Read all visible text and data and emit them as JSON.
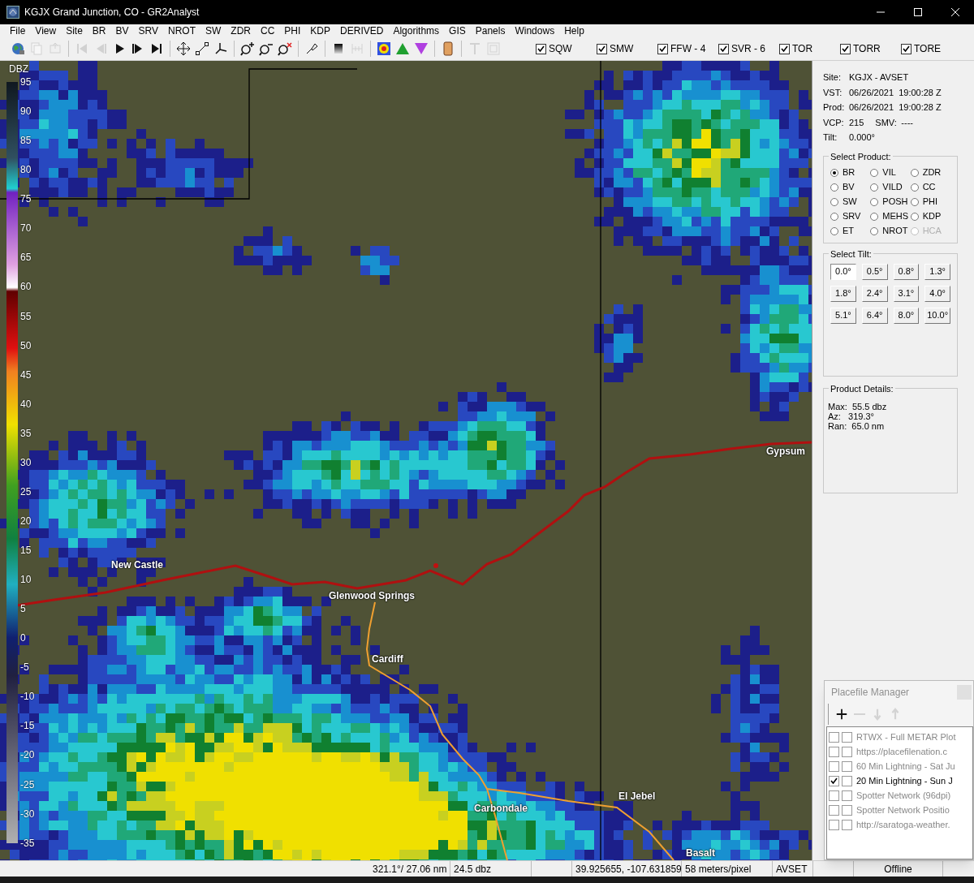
{
  "window": {
    "title": "KGJX Grand Junction, CO - GR2Analyst"
  },
  "menu": [
    "File",
    "View",
    "Site",
    "BR",
    "BV",
    "SRV",
    "NROT",
    "SW",
    "ZDR",
    "CC",
    "PHI",
    "KDP",
    "DERIVED",
    "Algorithms",
    "GIS",
    "Panels",
    "Windows",
    "Help"
  ],
  "toolbar": [
    {
      "kind": "globe",
      "disabled": false
    },
    {
      "kind": "copy",
      "disabled": true
    },
    {
      "kind": "export",
      "disabled": true
    },
    {
      "kind": "separator"
    },
    {
      "kind": "first",
      "disabled": true
    },
    {
      "kind": "prev",
      "disabled": true
    },
    {
      "kind": "play",
      "disabled": false
    },
    {
      "kind": "next",
      "disabled": false
    },
    {
      "kind": "last",
      "disabled": false
    },
    {
      "kind": "separator"
    },
    {
      "kind": "pan",
      "disabled": false
    },
    {
      "kind": "measure",
      "disabled": false
    },
    {
      "kind": "fork",
      "disabled": false
    },
    {
      "kind": "separator"
    },
    {
      "kind": "zoomin",
      "disabled": false
    },
    {
      "kind": "zoomout",
      "disabled": false
    },
    {
      "kind": "zoomreset",
      "disabled": false
    },
    {
      "kind": "separator"
    },
    {
      "kind": "pick",
      "disabled": false
    },
    {
      "kind": "separator"
    },
    {
      "kind": "gradient",
      "disabled": false
    },
    {
      "kind": "grid",
      "disabled": true
    },
    {
      "kind": "separator"
    },
    {
      "kind": "colormap",
      "disabled": false
    },
    {
      "kind": "up",
      "disabled": false
    },
    {
      "kind": "down",
      "disabled": false
    },
    {
      "kind": "separator"
    },
    {
      "kind": "tan",
      "disabled": false
    },
    {
      "kind": "separator"
    },
    {
      "kind": "text",
      "disabled": true
    },
    {
      "kind": "frame",
      "disabled": true
    }
  ],
  "warning_filters": [
    {
      "label": "SQW",
      "checked": true
    },
    {
      "label": "SMW",
      "checked": true
    },
    {
      "label": "FFW - 4",
      "checked": true
    },
    {
      "label": "SVR - 6",
      "checked": true
    },
    {
      "label": "TOR",
      "checked": true
    },
    {
      "label": "TORR",
      "checked": true
    },
    {
      "label": "TORE",
      "checked": true
    }
  ],
  "color_scale": {
    "unit": "DBZ",
    "ticks": [
      "95",
      "90",
      "85",
      "80",
      "75",
      "70",
      "65",
      "60",
      "55",
      "50",
      "45",
      "40",
      "35",
      "30",
      "25",
      "20",
      "15",
      "10",
      "5",
      "0",
      "-5",
      "-10",
      "-15",
      "-20",
      "-25",
      "-30",
      "-35"
    ]
  },
  "map": {
    "places": [
      {
        "label": "Gypsum"
      },
      {
        "label": "New Castle"
      },
      {
        "label": "Glenwood Springs"
      },
      {
        "label": "Cardiff"
      },
      {
        "label": "Carbondale"
      },
      {
        "label": "El Jebel"
      },
      {
        "label": "Basalt"
      }
    ]
  },
  "info": [
    {
      "fields": [
        {
          "label": "Site:",
          "value": "KGJX - AVSET"
        }
      ]
    },
    {
      "fields": [
        {
          "label": "VST:",
          "value": "06/26/2021  19:00:28 Z"
        }
      ]
    },
    {
      "fields": [
        {
          "label": "Prod:",
          "value": "06/26/2021  19:00:28 Z"
        }
      ]
    },
    {
      "fields": [
        {
          "label": "VCP:",
          "value": "215"
        },
        {
          "label": "SMV:",
          "value": "----"
        }
      ]
    },
    {
      "fields": [
        {
          "label": "Tilt:",
          "value": "0.000°"
        }
      ]
    }
  ],
  "select_product": {
    "title": "Select Product:",
    "options": [
      {
        "label": "BR",
        "selected": true,
        "disabled": false
      },
      {
        "label": "VIL",
        "selected": false,
        "disabled": false
      },
      {
        "label": "ZDR",
        "selected": false,
        "disabled": false
      },
      {
        "label": "BV",
        "selected": false,
        "disabled": false
      },
      {
        "label": "VILD",
        "selected": false,
        "disabled": false
      },
      {
        "label": "CC",
        "selected": false,
        "disabled": false
      },
      {
        "label": "SW",
        "selected": false,
        "disabled": false
      },
      {
        "label": "POSH",
        "selected": false,
        "disabled": false
      },
      {
        "label": "PHI",
        "selected": false,
        "disabled": false
      },
      {
        "label": "SRV",
        "selected": false,
        "disabled": false
      },
      {
        "label": "MEHS",
        "selected": false,
        "disabled": false
      },
      {
        "label": "KDP",
        "selected": false,
        "disabled": false
      },
      {
        "label": "ET",
        "selected": false,
        "disabled": false
      },
      {
        "label": "NROT",
        "selected": false,
        "disabled": false
      },
      {
        "label": "HCA",
        "selected": false,
        "disabled": true
      }
    ]
  },
  "select_tilt": {
    "title": "Select Tilt:",
    "buttons": [
      {
        "label": "0.0°",
        "selected": true
      },
      {
        "label": "0.5°",
        "selected": false
      },
      {
        "label": "0.8°",
        "selected": false
      },
      {
        "label": "1.3°",
        "selected": false
      },
      {
        "label": "1.8°",
        "selected": false
      },
      {
        "label": "2.4°",
        "selected": false
      },
      {
        "label": "3.1°",
        "selected": false
      },
      {
        "label": "4.0°",
        "selected": false
      },
      {
        "label": "5.1°",
        "selected": false
      },
      {
        "label": "6.4°",
        "selected": false
      },
      {
        "label": "8.0°",
        "selected": false
      },
      {
        "label": "10.0°",
        "selected": false
      }
    ]
  },
  "product_details": {
    "title": "Product Details:",
    "lines": [
      "Max:  55.5 dbz",
      "Az:   319.3°",
      "Ran:  65.0 nm"
    ]
  },
  "placefile_manager": {
    "title": "Placefile Manager",
    "tools": [
      {
        "kind": "add",
        "disabled": false
      },
      {
        "kind": "remove",
        "disabled": true
      },
      {
        "kind": "movedown",
        "disabled": true
      },
      {
        "kind": "moveup",
        "disabled": true
      }
    ],
    "items": [
      {
        "label": "RTWX - Full METAR Plot",
        "checks": [
          false,
          false
        ]
      },
      {
        "label": "https://placefilenation.c",
        "checks": [
          false,
          false
        ]
      },
      {
        "label": "60 Min Lightning - Sat Ju",
        "checks": [
          false,
          false
        ]
      },
      {
        "label": "20 Min Lightning - Sun J",
        "checks": [
          true,
          false
        ]
      },
      {
        "label": "Spotter Network (96dpi)",
        "checks": [
          false,
          false
        ]
      },
      {
        "label": "Spotter Network Positio",
        "checks": [
          false,
          false
        ]
      },
      {
        "label": "http://saratoga-weather.",
        "checks": [
          false,
          false
        ]
      }
    ]
  },
  "status_bar": [
    "321.1°/ 27.06 nm",
    "24.5 dbz",
    "39.925655, -107.631859",
    "58 meters/pixel",
    "AVSET",
    "Offline"
  ]
}
